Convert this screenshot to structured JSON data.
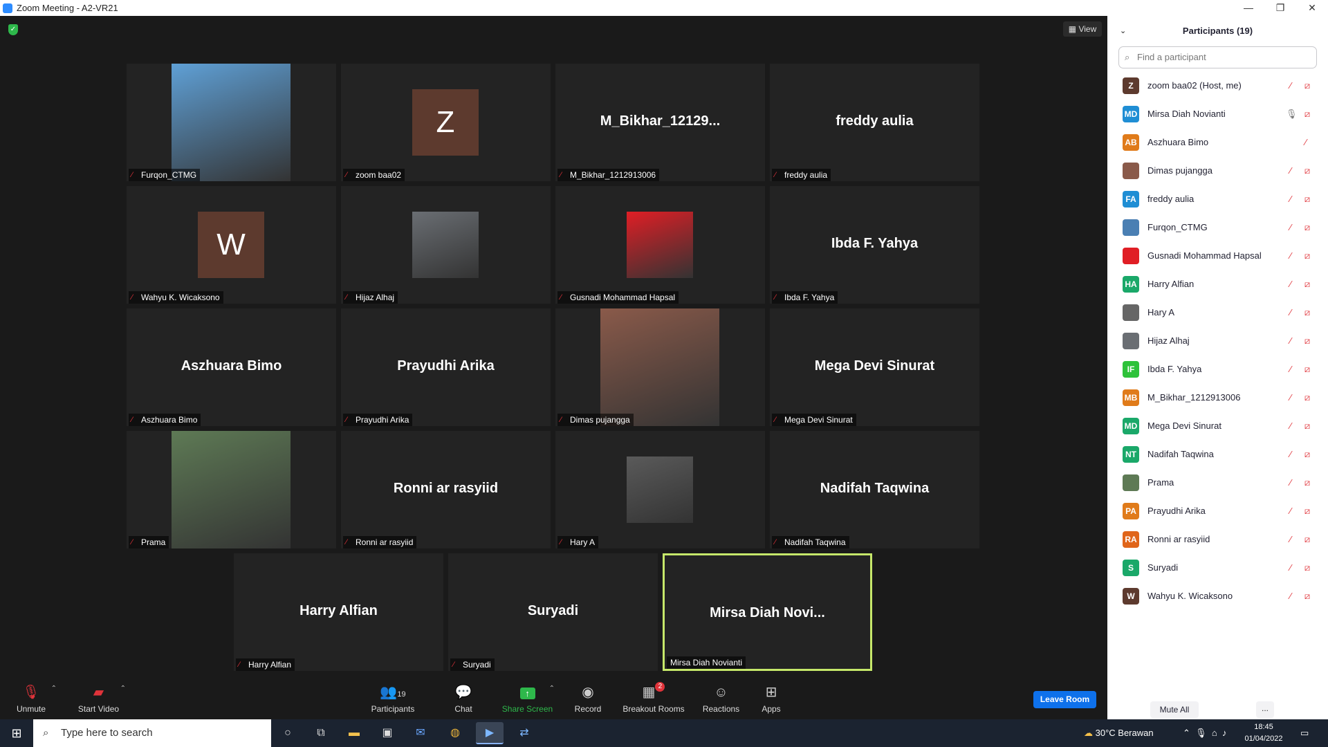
{
  "window": {
    "title": "Zoom Meeting - A2-VR21",
    "minimize": "—",
    "maximize": "❐",
    "close": "✕"
  },
  "meeting": {
    "view_label": "View",
    "shield": "✓"
  },
  "tiles": [
    {
      "name": "Furqon_CTMG",
      "kind": "photo",
      "color": "#5fa0d6"
    },
    {
      "name": "zoom baa02",
      "kind": "avatar",
      "initial": "Z",
      "color": "#5d3a2e"
    },
    {
      "name": "M_Bikhar_1212913006",
      "kind": "text",
      "big": "M_Bikhar_12129..."
    },
    {
      "name": "freddy aulia",
      "kind": "text",
      "big": "freddy aulia"
    },
    {
      "name": "Wahyu K. Wicaksono",
      "kind": "avatar",
      "initial": "W",
      "color": "#5d3a2e"
    },
    {
      "name": "Hijaz Alhaj",
      "kind": "photo-sm",
      "color": "#6a6e73"
    },
    {
      "name": "Gusnadi Mohammad Hapsal",
      "kind": "photo-sm",
      "color": "#e01e25"
    },
    {
      "name": "Ibda F. Yahya",
      "kind": "text",
      "big": "Ibda F. Yahya"
    },
    {
      "name": "Aszhuara Bimo",
      "kind": "text",
      "big": "Aszhuara Bimo"
    },
    {
      "name": "Prayudhi Arika",
      "kind": "text",
      "big": "Prayudhi Arika"
    },
    {
      "name": "Dimas pujangga",
      "kind": "photo",
      "color": "#8a5a4a"
    },
    {
      "name": "Mega Devi Sinurat",
      "kind": "text",
      "big": "Mega Devi Sinurat"
    },
    {
      "name": "Prama",
      "kind": "photo",
      "color": "#5e7a55"
    },
    {
      "name": "Ronni ar rasyiid",
      "kind": "text",
      "big": "Ronni ar rasyiid"
    },
    {
      "name": "Hary A",
      "kind": "photo-sm",
      "color": "#5a5a5a"
    },
    {
      "name": "Nadifah Taqwina",
      "kind": "text",
      "big": "Nadifah Taqwina"
    },
    {
      "name": "Harry Alfian",
      "kind": "text",
      "big": "Harry Alfian"
    },
    {
      "name": "Suryadi",
      "kind": "text",
      "big": "Suryadi"
    },
    {
      "name": "Mirsa Diah Novianti",
      "kind": "text",
      "big": "Mirsa Diah Novi...",
      "active": true
    }
  ],
  "toolbar": {
    "unmute": "Unmute",
    "start_video": "Start Video",
    "participants": "Participants",
    "participants_count": "19",
    "chat": "Chat",
    "share_screen": "Share Screen",
    "record": "Record",
    "breakout_rooms": "Breakout Rooms",
    "breakout_badge": "2",
    "reactions": "Reactions",
    "apps": "Apps",
    "leave_room": "Leave Room",
    "share_color": "#2eb84b",
    "leave_color": "#0e71eb"
  },
  "panel": {
    "title": "Participants (19)",
    "search_placeholder": "Find a participant",
    "mute_all": "Mute All",
    "more": "...",
    "participants": [
      {
        "name": "zoom baa02 (Host, me)",
        "initials": "Z",
        "color": "#5d3a2e",
        "mic": "muted",
        "cam": "off"
      },
      {
        "name": "Mirsa Diah Novianti",
        "initials": "MD",
        "color": "#1f8ed4",
        "mic": "on",
        "cam": "off"
      },
      {
        "name": "Aszhuara Bimo",
        "initials": "AB",
        "color": "#e07b1a",
        "mic": "muted",
        "cam": "none"
      },
      {
        "name": "Dimas pujangga",
        "initials": "",
        "color": "#8a5a4a",
        "mic": "muted",
        "cam": "off"
      },
      {
        "name": "freddy aulia",
        "initials": "FA",
        "color": "#1f8ed4",
        "mic": "muted",
        "cam": "off"
      },
      {
        "name": "Furqon_CTMG",
        "initials": "",
        "color": "#4a7fb3",
        "mic": "muted",
        "cam": "off"
      },
      {
        "name": "Gusnadi Mohammad Hapsal",
        "initials": "",
        "color": "#e01e25",
        "mic": "muted",
        "cam": "off"
      },
      {
        "name": "Harry Alfian",
        "initials": "HA",
        "color": "#1aa869",
        "mic": "muted",
        "cam": "off"
      },
      {
        "name": "Hary A",
        "initials": "",
        "color": "#666666",
        "mic": "muted",
        "cam": "off"
      },
      {
        "name": "Hijaz Alhaj",
        "initials": "",
        "color": "#6a6e73",
        "mic": "muted",
        "cam": "off"
      },
      {
        "name": "Ibda F. Yahya",
        "initials": "IF",
        "color": "#2ec23a",
        "mic": "muted",
        "cam": "off"
      },
      {
        "name": "M_Bikhar_1212913006",
        "initials": "MB",
        "color": "#e07b1a",
        "mic": "muted",
        "cam": "off"
      },
      {
        "name": "Mega Devi Sinurat",
        "initials": "MD",
        "color": "#1aa869",
        "mic": "muted",
        "cam": "off"
      },
      {
        "name": "Nadifah Taqwina",
        "initials": "NT",
        "color": "#1aa869",
        "mic": "muted",
        "cam": "off"
      },
      {
        "name": "Prama",
        "initials": "",
        "color": "#5e7a55",
        "mic": "muted",
        "cam": "off"
      },
      {
        "name": "Prayudhi Arika",
        "initials": "PA",
        "color": "#e07b1a",
        "mic": "muted",
        "cam": "off"
      },
      {
        "name": "Ronni ar rasyiid",
        "initials": "RA",
        "color": "#e0651a",
        "mic": "muted",
        "cam": "off"
      },
      {
        "name": "Suryadi",
        "initials": "S",
        "color": "#1aa869",
        "mic": "muted",
        "cam": "off"
      },
      {
        "name": "Wahyu K. Wicaksono",
        "initials": "W",
        "color": "#5d3a2e",
        "mic": "muted",
        "cam": "off"
      }
    ]
  },
  "taskbar": {
    "search_placeholder": "Type here to search",
    "weather": "30°C  Berawan",
    "time": "18:45",
    "date": "01/04/2022"
  }
}
